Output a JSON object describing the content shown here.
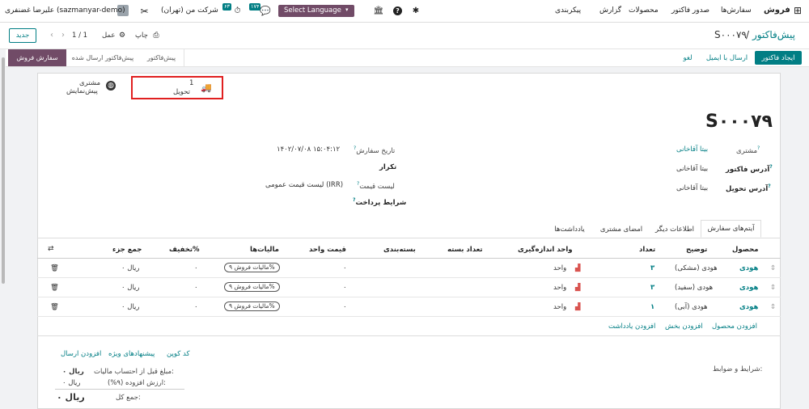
{
  "navbar": {
    "app_name": "فروش",
    "menu": [
      "سفارش‌ها",
      "صدور فاکتور",
      "محصولات",
      "گزارش",
      "پیکربندی"
    ],
    "company": "شرکت من (تهران)",
    "user": "علیرضا غضنفری (sazmanyar-demo)",
    "language_label": "Select Language",
    "activity_count": "۶۳",
    "message_count": "۱۷۴"
  },
  "control": {
    "breadcrumb_parent": "پیش‌فاکتور",
    "breadcrumb_current": "S۰۰۰۷۹",
    "print_label": "چاپ",
    "action_label": "عمل",
    "pager": "1 / 1",
    "new_label": "جدید"
  },
  "actions": {
    "create_invoice": "ایجاد فاکتور",
    "send_email": "ارسال با ایمیل",
    "cancel": "لغو",
    "stages": [
      "پیش‌فاکتور",
      "پیش‌فاکتور ارسال شده",
      "سفارش فروش"
    ]
  },
  "smart_buttons": {
    "delivery_count": "1",
    "delivery_label": "تحویل",
    "preview_label_1": "مشتری",
    "preview_label_2": "پیش‌نمایش"
  },
  "order": {
    "name": "S۰۰۰۷۹",
    "customer_label": "مشتری",
    "customer": "بیتا آقاخانی",
    "invoice_address_label": "آدرس فاکتور",
    "invoice_address": "بیتا آقاخانی",
    "delivery_address_label": "آدرس تحویل",
    "delivery_address": "بیتا آقاخانی",
    "order_date_label": "تاریخ سفارش",
    "order_date": "۱۴۰۲/۰۷/۰۸ ۱۵:۰۴:۱۲",
    "recurrence_label": "تکرار",
    "pricelist_label": "لیست قیمت",
    "pricelist": "لیست قیمت عمومی (IRR)",
    "payment_terms_label": "شرایط پرداخت"
  },
  "tabs": [
    "آیتم‌های سفارش",
    "اطلاعات دیگر",
    "امضای مشتری",
    "یادداشت‌ها"
  ],
  "table": {
    "columns": [
      "محصول",
      "توضیح",
      "تعداد",
      "واحد اندازه‌گیری",
      "تعداد بسته",
      "بسته‌بندی",
      "قیمت واحد",
      "مالیات‌ها",
      "تخفیف%",
      "جمع جزء"
    ],
    "rows": [
      {
        "product": "هودی",
        "description": "هودی (مشکی)",
        "qty": "۳",
        "uom": "واحد",
        "price": "۰",
        "tax": "مالیات فروش ۹%",
        "discount": "۰",
        "subtotal": "ریال ۰"
      },
      {
        "product": "هودی",
        "description": "هودی (سفید)",
        "qty": "۳",
        "uom": "واحد",
        "price": "۰",
        "tax": "مالیات فروش ۹%",
        "discount": "۰",
        "subtotal": "ریال ۰"
      },
      {
        "product": "هودی",
        "description": "هودی (آبی)",
        "qty": "۱",
        "uom": "واحد",
        "price": "۰",
        "tax": "مالیات فروش ۹%",
        "discount": "۰",
        "subtotal": "ریال ۰"
      }
    ],
    "add_product": "افزودن محصول",
    "add_section": "افزودن بخش",
    "add_note": "افزودن یادداشت"
  },
  "footer": {
    "coupon_code": "کد کوپن",
    "promotions": "پیشنهادهای ویژه",
    "add_shipping": "افزودن ارسال",
    "terms_label": "شرایط و ضوابط:",
    "untaxed_label": "مبلغ قبل از احتساب مالیات:",
    "untaxed_value": "ریال ۰",
    "vat_label": "ارزش افزوده (۹%):",
    "vat_value": "ریال ۰",
    "total_label": "جمع کل:",
    "total_value": "ریال ۰"
  },
  "colors": {
    "brand": "#714b67",
    "teal": "#017e84",
    "highlight": "#e02020"
  }
}
